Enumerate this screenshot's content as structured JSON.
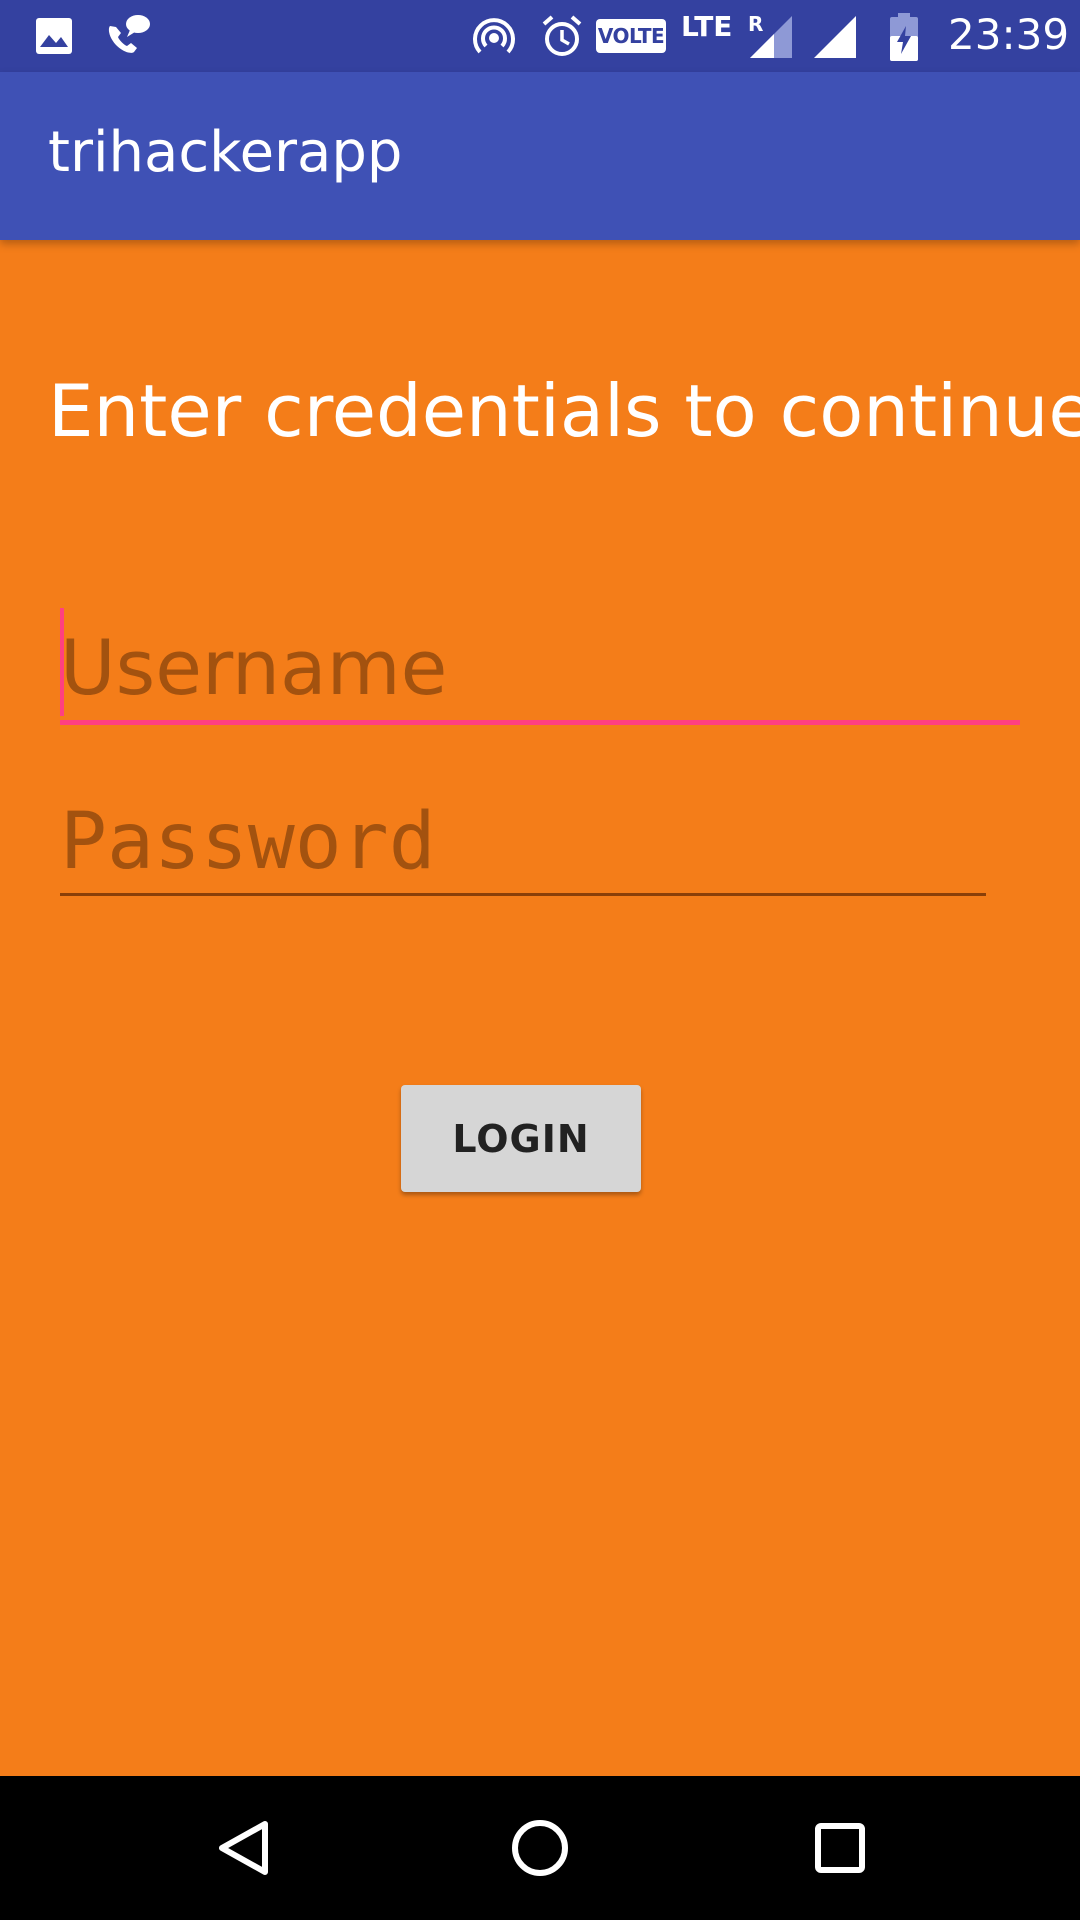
{
  "status_bar": {
    "icons": [
      "image-icon",
      "call-icon",
      "hotspot-icon",
      "alarm-icon",
      "signal-icon",
      "battery-charging-icon"
    ],
    "volte_label": "VOLTE",
    "network_label": "LTE",
    "roaming_label": "R",
    "time": "23:39",
    "background_color": "#3441A0"
  },
  "app_bar": {
    "title": "trihackerapp",
    "background_color": "#3F51B5"
  },
  "main": {
    "prompt": "Enter credentials to continue.",
    "username": {
      "value": "",
      "placeholder": "Username"
    },
    "password": {
      "value": "",
      "placeholder": "Password"
    },
    "login_label": "LOGIN",
    "background_color": "#F47D19",
    "accent_color": "#FF4081"
  },
  "nav_bar": {
    "buttons": [
      "back-icon",
      "home-icon",
      "recents-icon"
    ]
  }
}
